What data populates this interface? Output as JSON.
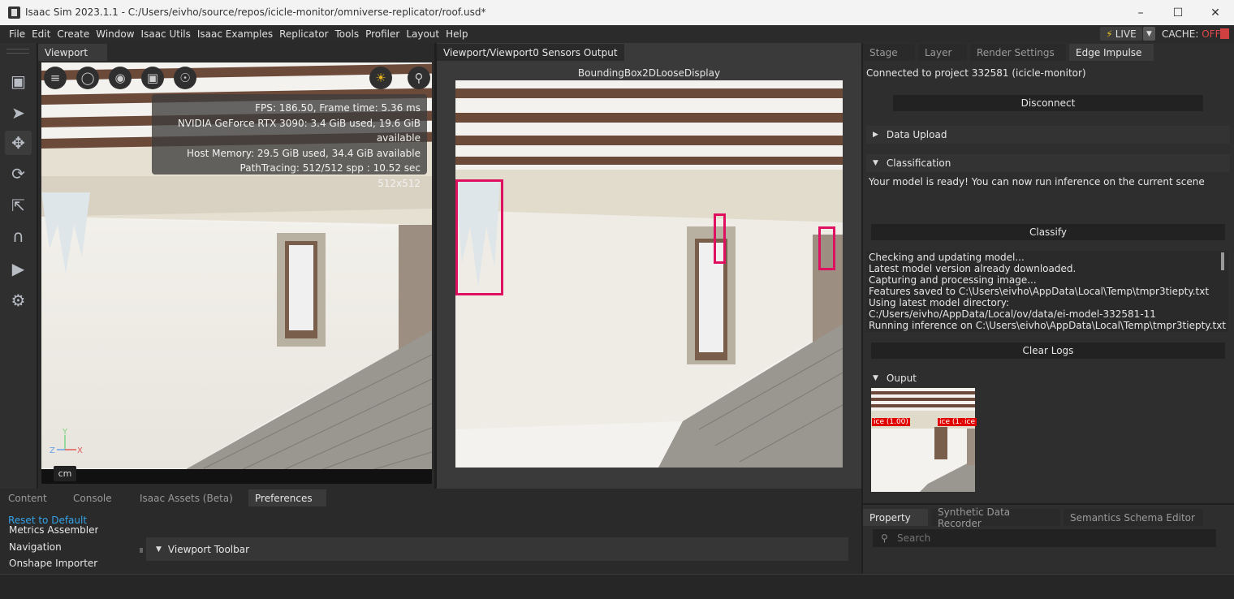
{
  "titlebar": {
    "title": "Isaac Sim 2023.1.1 - C:/Users/eivho/source/repos/icicle-monitor/omniverse-replicator/roof.usd*",
    "icons": [
      "minimize-icon",
      "maximize-icon",
      "close-icon"
    ]
  },
  "menu": [
    "File",
    "Edit",
    "Create",
    "Window",
    "Isaac Utils",
    "Isaac Examples",
    "Replicator",
    "Tools",
    "Profiler",
    "Layout",
    "Help"
  ],
  "live": {
    "label": "LIVE"
  },
  "cache": {
    "label": "CACHE:",
    "state": "OFF"
  },
  "viewport": {
    "tab": "Viewport",
    "stats": [
      "FPS: 186.50, Frame time: 5.36 ms",
      "NVIDIA GeForce RTX 3090: 3.4 GiB used, 19.6 GiB available",
      "Host Memory: 29.5 GiB used, 34.4 GiB available",
      "PathTracing: 512/512 spp : 10.52 sec",
      "512x512"
    ],
    "axis": {
      "y": "Y",
      "z": "Z",
      "x": "X"
    },
    "unit": "cm"
  },
  "sensors": {
    "tab": "Viewport/Viewport0 Sensors Output",
    "label": "BoundingBox2DLooseDisplay"
  },
  "right": {
    "tabs": [
      "Stage",
      "Layer",
      "Render Settings",
      "Edge Impulse"
    ],
    "connected": "Connected to project 332581 (icicle-monitor)",
    "disconnect": "Disconnect",
    "data_upload": "Data Upload",
    "classification": "Classification",
    "ready": "Your model is ready! You can now run inference on the current scene",
    "classify": "Classify",
    "logs": [
      "Checking and updating model...",
      "Latest model version already downloaded.",
      "Capturing and processing image...",
      "Features saved to C:\\Users\\eivho\\AppData\\Local\\Temp\\tmpr3tiepty.txt",
      "Using latest model directory:",
      "C:/Users/eivho/AppData/Local/ov/data/ei-model-332581-11",
      "Running inference on C:\\Users\\eivho\\AppData\\Local\\Temp\\tmpr3tiepty.txt"
    ],
    "clear_logs": "Clear Logs",
    "output": "Ouput",
    "detections": [
      "ice (1.00)",
      "ice (1.(",
      "ice"
    ]
  },
  "bottom": {
    "tabs": [
      "Content",
      "Console",
      "Isaac Assets (Beta)",
      "Preferences"
    ],
    "reset": "Reset to Default",
    "nav_items": [
      "Metrics Assembler",
      "Navigation",
      "Onshape Importer"
    ],
    "viewport_toolbar": "Viewport Toolbar"
  },
  "property": {
    "tabs": [
      "Property",
      "Synthetic Data Recorder",
      "Semantics Schema Editor"
    ],
    "search_placeholder": "Search"
  }
}
